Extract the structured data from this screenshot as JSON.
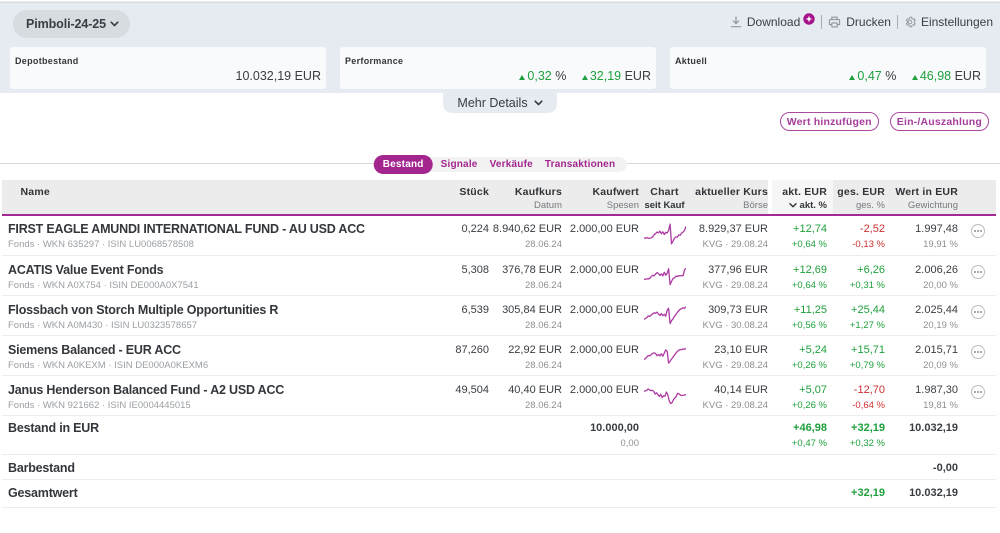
{
  "brand": {
    "magenta": "#a2268e",
    "green": "#1fa03c",
    "red": "#cd2f32"
  },
  "header": {
    "depot_selector": "Pimboli-24-25",
    "actions": {
      "download": "Download",
      "print": "Drucken",
      "settings": "Einstellungen"
    }
  },
  "summary_cards": [
    {
      "label": "Depotbestand",
      "value": "10.032,19 EUR"
    },
    {
      "label": "Performance",
      "pct": "0,32",
      "pct_unit": "%",
      "amount": "32,19",
      "amount_unit": "EUR"
    },
    {
      "label": "Aktuell",
      "pct": "0,47",
      "pct_unit": "%",
      "amount": "46,98",
      "amount_unit": "EUR"
    }
  ],
  "mehr_details_label": "Mehr Details",
  "cta_buttons": {
    "add_value": "Wert hinzufügen",
    "payment": "Ein-/Auszahlung"
  },
  "tabs": [
    {
      "label": "Bestand",
      "active": true
    },
    {
      "label": "Signale",
      "active": false
    },
    {
      "label": "Verkäufe",
      "active": false
    },
    {
      "label": "Transaktionen",
      "active": false
    }
  ],
  "table": {
    "columns": {
      "name": "Name",
      "stueck": "Stück",
      "kaufkurs": "Kaufkurs",
      "kaufkurs2": "Datum",
      "kaufwert": "Kaufwert",
      "kaufwert2": "Spesen",
      "chart": "Chart",
      "chart2": "seit Kauf",
      "kurs": "aktueller Kurs",
      "kurs2": "Börse",
      "akt": "akt. EUR",
      "akt2": "akt. %",
      "ges": "ges. EUR",
      "ges2": "ges. %",
      "wert": "Wert in EUR",
      "wert2": "Gewichtung"
    },
    "rows": [
      {
        "name": "FIRST EAGLE AMUNDI INTERNATIONAL FUND - AU USD ACC",
        "meta": "Fonds · WKN 635297 · ISIN LU0068578508",
        "stueck": "0,224",
        "kaufkurs": "8.940,62 EUR",
        "datum": "28.06.24",
        "kaufwert": "2.000,00 EUR",
        "kurs": "8.929,37 EUR",
        "boerse": "KVG · 29.08.24",
        "akt_eur": "+12,74",
        "akt_pct": "+0,64 %",
        "akt_cls": "green",
        "ges_eur": "-2,52",
        "ges_pct": "-0,13 %",
        "ges_cls": "red",
        "wert": "1.997,48",
        "gewichtung": "19,91 %",
        "spark": [
          3.2,
          3.0,
          3.3,
          3.1,
          3.0,
          3.2,
          3.6,
          4.5,
          4.9,
          5.6,
          5.3,
          6.0,
          4.9,
          5.7,
          4.6,
          5.5,
          5.2,
          6.3,
          8.9,
          0.7,
          1.8,
          3.0,
          3.6,
          3.5,
          4.4,
          4.3,
          5.2,
          5.6,
          6.4,
          8.0
        ]
      },
      {
        "name": "ACATIS Value Event Fonds",
        "meta": "Fonds · WKN A0X754 · ISIN DE000A0X7541",
        "stueck": "5,308",
        "kaufkurs": "376,78 EUR",
        "datum": "28.06.24",
        "kaufwert": "2.000,00 EUR",
        "kurs": "377,96 EUR",
        "boerse": "KVG · 29.08.24",
        "akt_eur": "+12,69",
        "akt_pct": "+0,64 %",
        "akt_cls": "green",
        "ges_eur": "+6,26",
        "ges_pct": "+0,31 %",
        "ges_cls": "green",
        "wert": "2.006,26",
        "gewichtung": "20,00 %",
        "spark": [
          3.1,
          3.0,
          3.2,
          3.1,
          3.4,
          4.1,
          4.7,
          4.4,
          5.2,
          5.8,
          5.4,
          4.6,
          5.3,
          4.4,
          5.9,
          4.7,
          5.5,
          7.4,
          0.8,
          2.1,
          3.3,
          3.6,
          4.3,
          4.2,
          4.5,
          4.4,
          4.6,
          4.5,
          7.0,
          7.6
        ]
      },
      {
        "name": "Flossbach von Storch Multiple Opportunities R",
        "meta": "Fonds · WKN A0M430 · ISIN LU0323578657",
        "stueck": "6,539",
        "kaufkurs": "305,84 EUR",
        "datum": "28.06.24",
        "kaufwert": "2.000,00 EUR",
        "kurs": "309,73 EUR",
        "boerse": "KVG · 30.08.24",
        "akt_eur": "+11,25",
        "akt_pct": "+0,56 %",
        "akt_cls": "green",
        "ges_eur": "+25,44",
        "ges_pct": "+1,27 %",
        "ges_cls": "green",
        "wert": "2.025,44",
        "gewichtung": "20,19 %",
        "spark": [
          3.0,
          3.3,
          3.8,
          4.4,
          4.2,
          4.8,
          5.3,
          5.7,
          5.5,
          6.0,
          5.2,
          4.6,
          5.4,
          4.5,
          5.1,
          4.3,
          6.8,
          7.6,
          1.2,
          2.4,
          3.2,
          4.2,
          5.0,
          5.9,
          6.6,
          7.2,
          7.4,
          7.8,
          7.6,
          8.2
        ]
      },
      {
        "name": "Siemens Balanced - EUR ACC",
        "meta": "Fonds · WKN A0KEXM · ISIN DE000A0KEXM6",
        "stueck": "87,260",
        "kaufkurs": "22,92 EUR",
        "datum": "28.06.24",
        "kaufwert": "2.000,00 EUR",
        "kurs": "23,10 EUR",
        "boerse": "KVG · 29.08.24",
        "akt_eur": "+5,24",
        "akt_pct": "+0,26 %",
        "akt_cls": "green",
        "ges_eur": "+15,71",
        "ges_pct": "+0,79 %",
        "ges_cls": "green",
        "wert": "2.015,71",
        "gewichtung": "20,09 %",
        "spark": [
          2.9,
          3.3,
          4.0,
          4.6,
          4.4,
          5.0,
          5.5,
          5.7,
          5.4,
          4.5,
          5.0,
          4.4,
          5.3,
          4.3,
          5.6,
          6.9,
          6.3,
          1.4,
          2.2,
          3.1,
          3.9,
          4.7,
          5.6,
          6.3,
          6.8,
          7.1,
          7.0,
          7.3,
          7.2,
          7.6
        ]
      },
      {
        "name": "Janus Henderson Balanced Fund - A2 USD ACC",
        "meta": "Fonds · WKN 921662 · ISIN IE0004445015",
        "stueck": "49,504",
        "kaufkurs": "40,40 EUR",
        "datum": "28.06.24",
        "kaufwert": "2.000,00 EUR",
        "kurs": "40,14 EUR",
        "boerse": "KVG · 29.08.24",
        "akt_eur": "+5,07",
        "akt_pct": "+0,26 %",
        "akt_cls": "green",
        "ges_eur": "-12,70",
        "ges_pct": "-0,64 %",
        "ges_cls": "red",
        "wert": "1.987,30",
        "gewichtung": "19,81 %",
        "spark": [
          6.3,
          6.5,
          6.8,
          7.3,
          6.9,
          6.6,
          6.8,
          6.2,
          5.2,
          5.7,
          4.9,
          4.2,
          5.1,
          3.7,
          4.5,
          4.3,
          6.0,
          4.9,
          2.4,
          1.2,
          1.6,
          2.8,
          3.5,
          4.2,
          5.5,
          5.3,
          4.8,
          4.5,
          4.7,
          4.8,
          5.0
        ]
      }
    ],
    "footer": {
      "bestand": {
        "label": "Bestand in EUR",
        "kaufwert": "10.000,00",
        "spesen": "0,00",
        "akt_eur": "+46,98",
        "akt_pct": "+0,47 %",
        "ges_eur": "+32,19",
        "ges_pct": "+0,32 %",
        "wert": "10.032,19"
      },
      "barbestand": {
        "label": "Barbestand",
        "wert": "-0,00"
      },
      "gesamtwert": {
        "label": "Gesamtwert",
        "ges_eur": "+32,19",
        "wert": "10.032,19"
      }
    }
  }
}
